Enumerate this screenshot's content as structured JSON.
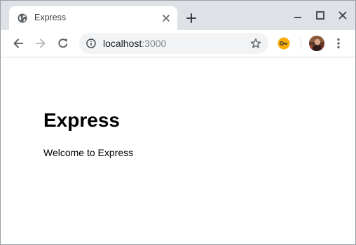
{
  "browser": {
    "tab": {
      "title": "Express",
      "favicon": "globe-icon"
    },
    "new_tab_icon": "plus-icon",
    "window_controls": [
      "minimize-icon",
      "maximize-icon",
      "close-icon"
    ],
    "toolbar": {
      "back_icon": "arrow-left-icon",
      "forward_icon": "arrow-right-icon",
      "reload_icon": "reload-icon",
      "site_info_icon": "info-icon",
      "url_host": "localhost",
      "url_port": ":3000",
      "bookmark_icon": "star-icon",
      "extension_icon": "key-icon",
      "menu_icon": "more-vert-icon"
    }
  },
  "page": {
    "heading": "Express",
    "text": "Welcome to Express"
  },
  "colors": {
    "tabstrip": "#dee1e6",
    "omnibox": "#f1f3f4",
    "icon": "#5f6368",
    "extension": "#f9ab00"
  }
}
